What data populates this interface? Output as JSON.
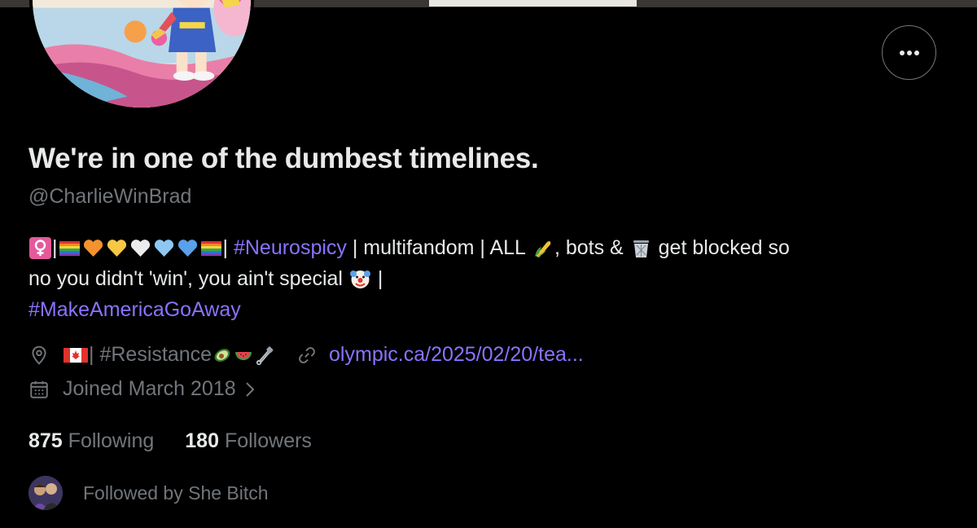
{
  "profile": {
    "display_name": "We're in one of the dumbest timelines.",
    "handle": "@CharlieWinBrad"
  },
  "bio": {
    "hashtag_1": "#Neurospicy",
    "text_1": " | multifandom | ALL ",
    "text_2": ", bots & ",
    "text_3": " get blocked so",
    "text_4": "no you didn't 'win', you ain't special ",
    "text_5": " |",
    "hashtag_2": "#MakeAmericaGoAway"
  },
  "meta": {
    "location_hashtag": "#Resistance",
    "link": "olympic.ca/2025/02/20/tea...",
    "joined": "Joined March 2018"
  },
  "stats": {
    "following_count": "875",
    "following_label": "Following",
    "followers_count": "180",
    "followers_label": "Followers"
  },
  "followed_by": {
    "text": "Followed by She Bitch"
  },
  "icons": {
    "more": "more-horizontal-icon",
    "location": "location-pin-icon",
    "link": "link-icon",
    "calendar": "calendar-icon",
    "chevron": "chevron-right-icon"
  },
  "colors": {
    "background": "#000000",
    "text": "#e7e9ea",
    "secondary": "#71767b",
    "accent": "#8b72ff"
  }
}
